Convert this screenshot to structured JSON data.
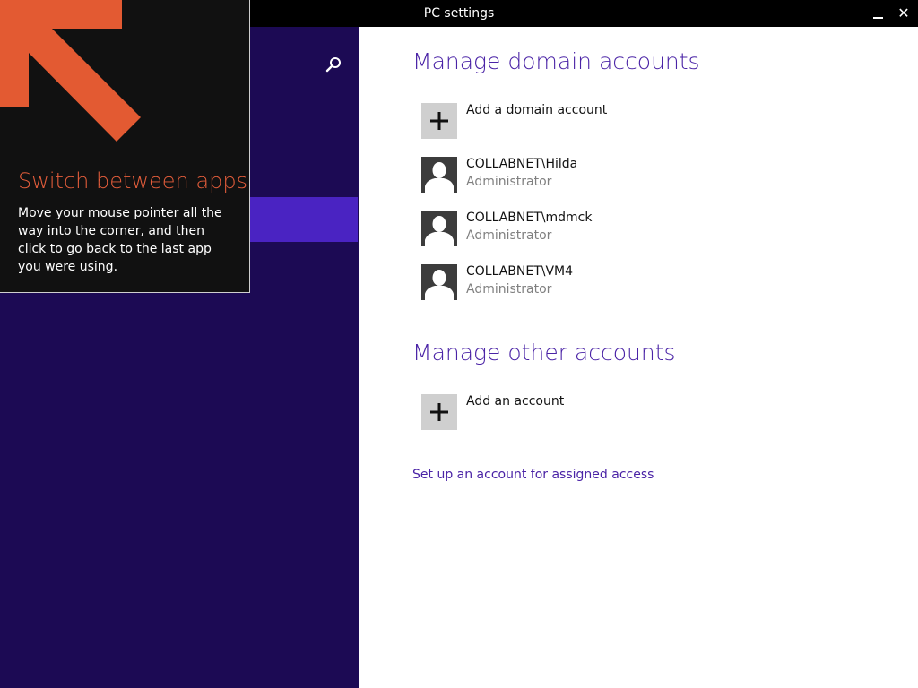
{
  "window": {
    "title": "PC settings",
    "minimize_icon": "minimize-icon",
    "close_icon": "close-icon",
    "close_glyph": "✕"
  },
  "nav": {
    "search_icon": "search-icon"
  },
  "tip": {
    "title": "Switch between apps",
    "body": "Move your mouse pointer all the way into the corner, and then click to go back to the last app you were using.",
    "arrow_color": "#e35a32"
  },
  "domain_accounts": {
    "heading": "Manage domain accounts",
    "add_label": "Add a domain account",
    "accounts": [
      {
        "name": "COLLABNET\\Hilda",
        "role": "Administrator"
      },
      {
        "name": "COLLABNET\\mdmck",
        "role": "Administrator"
      },
      {
        "name": "COLLABNET\\VM4",
        "role": "Administrator"
      }
    ]
  },
  "other_accounts": {
    "heading": "Manage other accounts",
    "add_label": "Add an account"
  },
  "assigned_access_link": "Set up an account for assigned access",
  "colors": {
    "nav_background": "#1c0a54",
    "nav_selected": "#4a23c2",
    "heading_accent": "#4a23a6",
    "tip_title": "#e45d3b"
  }
}
